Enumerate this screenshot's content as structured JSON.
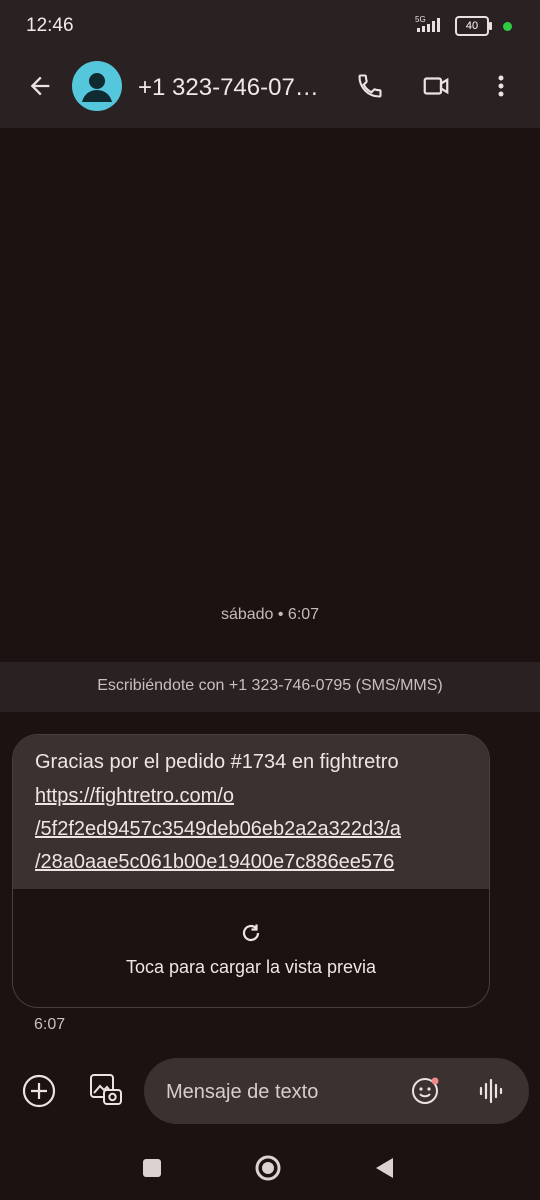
{
  "status_bar": {
    "time": "12:46",
    "network": "5G",
    "battery": "40"
  },
  "header": {
    "contact": "+1 323-746-07…",
    "icons": [
      "back-arrow-icon",
      "avatar-person-icon",
      "phone-icon",
      "video-icon",
      "more-vert-icon"
    ]
  },
  "conversation": {
    "date_separator": "sábado • 6:07",
    "info_banner": "Escribiéndote con +1 323-746-0795 (SMS/MMS)",
    "message": {
      "text_line1": "Gracias por el pedido #1734 en fightretro",
      "link_line1": "https://fightretro.com/o",
      "link_line2": "/5f2f2ed9457c3549deb06eb2a2a322d3/a",
      "link_line3": "/28a0aae5c061b00e19400e7c886ee576",
      "preview_label": "Toca para cargar la vista previa",
      "time": "6:07"
    }
  },
  "composer": {
    "placeholder": "Mensaje de texto"
  },
  "colors": {
    "background": "#1d1212",
    "bar": "#2a2222",
    "bubble": "#3b3131",
    "avatar": "#55c7dc"
  }
}
